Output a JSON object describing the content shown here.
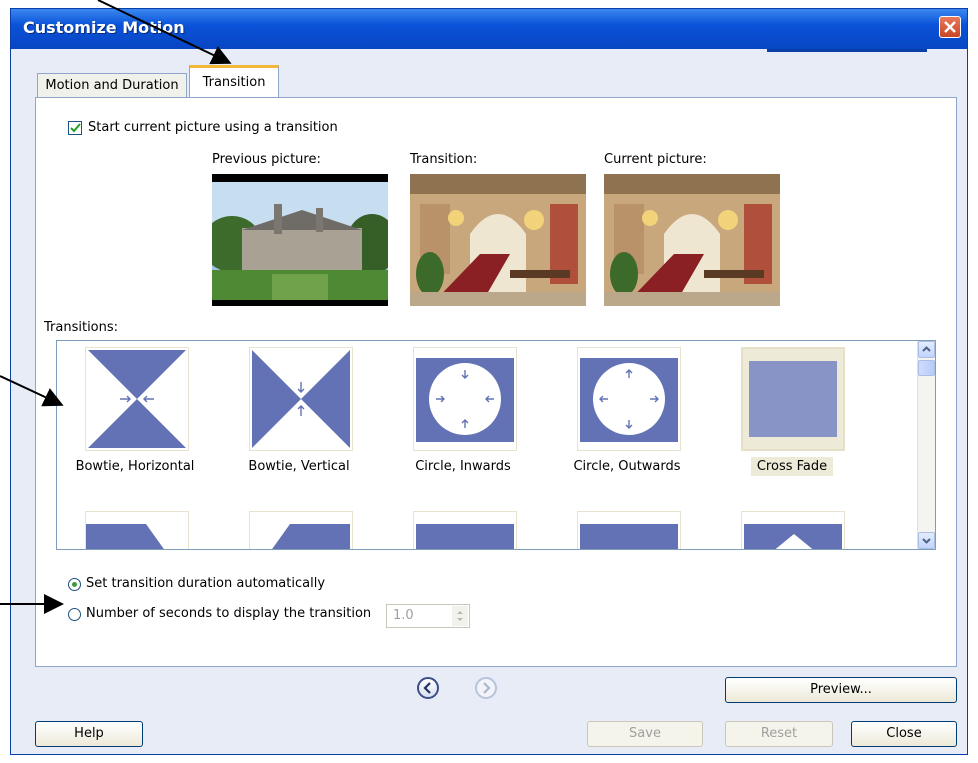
{
  "window": {
    "title": "Customize Motion"
  },
  "tabs": [
    {
      "label": "Motion and Duration",
      "active": false
    },
    {
      "label": "Transition",
      "active": true
    }
  ],
  "start_with_transition": {
    "label": "Start current picture using a transition",
    "checked": true
  },
  "previews": {
    "previous_label": "Previous picture:",
    "transition_label": "Transition:",
    "current_label": "Current picture:"
  },
  "transitions": {
    "label": "Transitions:",
    "items": [
      {
        "name": "Bowtie, Horizontal",
        "icon": "bowtie-horizontal-icon"
      },
      {
        "name": "Bowtie, Vertical",
        "icon": "bowtie-vertical-icon"
      },
      {
        "name": "Circle, Inwards",
        "icon": "circle-inwards-icon"
      },
      {
        "name": "Circle, Outwards",
        "icon": "circle-outwards-icon"
      },
      {
        "name": "Cross Fade",
        "icon": "cross-fade-icon",
        "selected": true
      }
    ]
  },
  "duration": {
    "auto_label": "Set transition duration automatically",
    "auto_selected": true,
    "manual_label": "Number of seconds to display the transition",
    "seconds_value": "1.0"
  },
  "buttons": {
    "preview": "Preview...",
    "help": "Help",
    "save": "Save",
    "reset": "Reset",
    "close": "Close"
  },
  "colors": {
    "accent": "#6272b4",
    "titlebar": "#0a52d8",
    "selection": "#eeead8"
  }
}
